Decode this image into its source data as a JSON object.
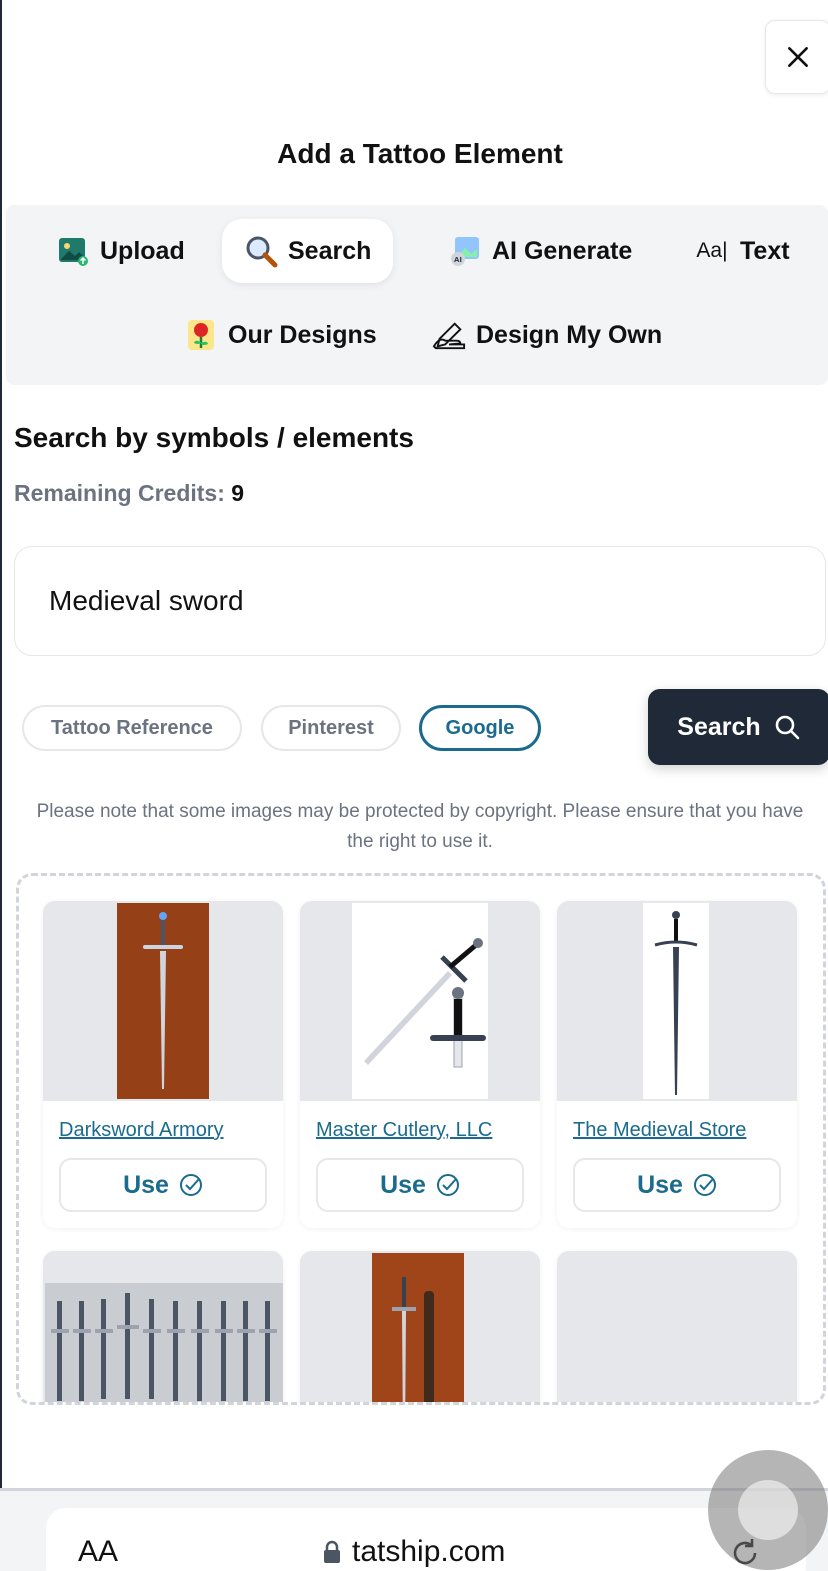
{
  "modal": {
    "title": "Add a Tattoo Element",
    "close_icon": "close-icon"
  },
  "tabs": [
    {
      "label": "Upload",
      "icon": "image-upload-icon",
      "active": false
    },
    {
      "label": "Search",
      "icon": "magnifier-icon",
      "active": true
    },
    {
      "label": "AI Generate",
      "icon": "ai-image-icon",
      "active": false
    },
    {
      "label": "Text",
      "icon": "text-cursor-icon",
      "active": false
    },
    {
      "label": "Our Designs",
      "icon": "rose-icon",
      "active": false
    },
    {
      "label": "Design My Own",
      "icon": "pen-hand-icon",
      "active": false
    }
  ],
  "search_section": {
    "title": "Search by symbols / elements",
    "credits_label": "Remaining Credits:",
    "credits_value": "9",
    "query": "Medieval sword"
  },
  "sources": [
    {
      "label": "Tattoo Reference",
      "active": false
    },
    {
      "label": "Pinterest",
      "active": false
    },
    {
      "label": "Google",
      "active": true
    }
  ],
  "search_button": {
    "label": "Search",
    "icon": "search-icon"
  },
  "notice": "Please note that some images may be protected by copyright. Please ensure that you have the right to use it.",
  "results": [
    {
      "source": "Darksword Armory",
      "use_label": "Use"
    },
    {
      "source": "Master Cutlery, LLC",
      "use_label": "Use"
    },
    {
      "source": "The Medieval Store",
      "use_label": "Use"
    }
  ],
  "browser": {
    "text_size_label": "AA",
    "url": "tatship.com"
  },
  "colors": {
    "accent": "#1b6b8f",
    "dark_button": "#1f2937",
    "panel_bg": "#f3f4f6",
    "muted_text": "#6b7280"
  }
}
